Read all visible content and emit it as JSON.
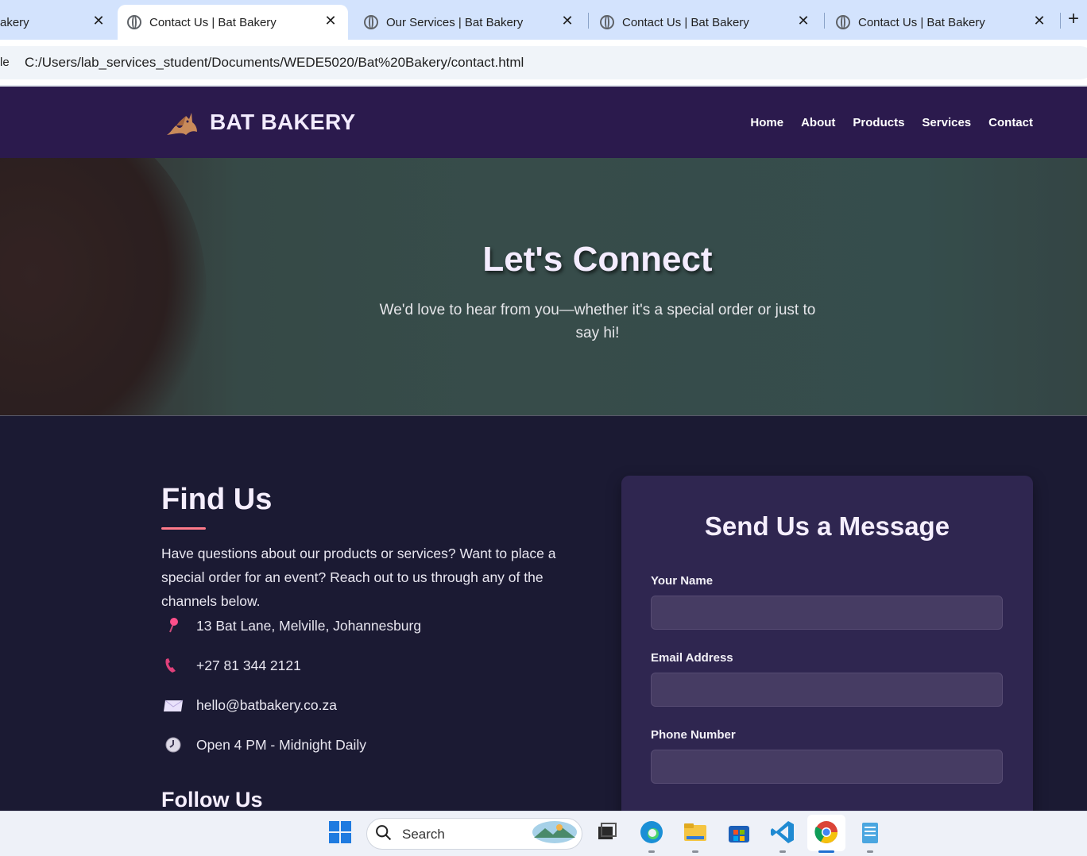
{
  "browser": {
    "tabs": [
      {
        "title": "akery"
      },
      {
        "title": "Contact Us | Bat Bakery"
      },
      {
        "title": "Our Services | Bat Bakery"
      },
      {
        "title": "Contact Us | Bat Bakery"
      },
      {
        "title": "Contact Us | Bat Bakery"
      }
    ],
    "new_tab": "+",
    "close_glyph": "✕",
    "address_prefix": "le",
    "url": "C:/Users/lab_services_student/Documents/WEDE5020/Bat%20Bakery/contact.html"
  },
  "site": {
    "brand": "BAT BAKERY",
    "logo_icon": "bat-icon",
    "nav": [
      "Home",
      "About",
      "Products",
      "Services",
      "Contact"
    ]
  },
  "hero": {
    "title": "Let's Connect",
    "subtitle": "We'd love to hear from you—whether it's a special order or just to say hi!"
  },
  "find_us": {
    "title": "Find Us",
    "intro": "Have questions about our products or services? Want to place a special order for an event? Reach out to us through any of the channels below.",
    "items": [
      {
        "icon": "pin-icon",
        "text": "13 Bat Lane, Melville, Johannesburg"
      },
      {
        "icon": "phone-icon",
        "text": "+27 81 344 2121"
      },
      {
        "icon": "envelope-icon",
        "text": "hello@batbakery.co.za"
      },
      {
        "icon": "clock-icon",
        "text": "Open 4 PM - Midnight Daily"
      }
    ],
    "follow_title": "Follow Us"
  },
  "form": {
    "title": "Send Us a Message",
    "fields": [
      {
        "label": "Your Name",
        "value": ""
      },
      {
        "label": "Email Address",
        "value": ""
      },
      {
        "label": "Phone Number",
        "value": ""
      }
    ]
  },
  "taskbar": {
    "search_placeholder": "Search"
  },
  "colors": {
    "nav_bg": "#2b1a4d",
    "page_bg": "#1b1a33",
    "card_bg": "#2f2650",
    "accent": "#ff7a8a"
  }
}
